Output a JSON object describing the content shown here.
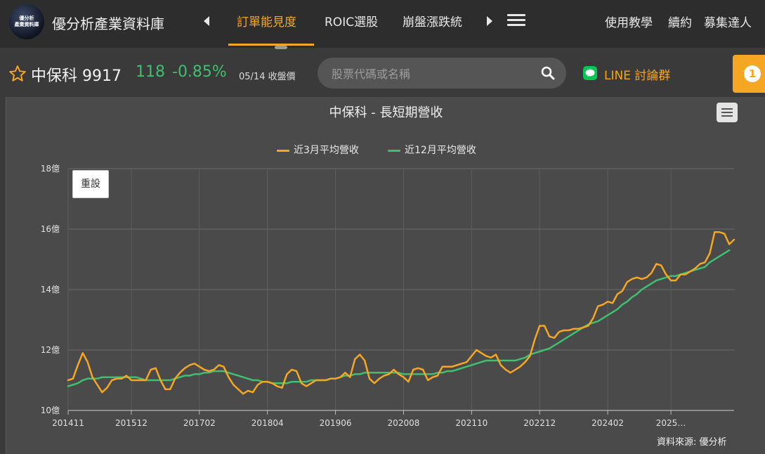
{
  "nav": {
    "logo_line1": "優分析",
    "logo_line2": "產業資料庫",
    "site_title": "優分析產業資料庫",
    "tabs": [
      "訂單能見度",
      "ROIC選股",
      "崩盤漲跌統"
    ],
    "active_tab": 0,
    "right_links": [
      "使用教學",
      "續約",
      "募集達人"
    ]
  },
  "stock": {
    "name": "中保科 9917",
    "price": "118",
    "change": "-0.85%",
    "date_label": "05/14 收盤價",
    "change_color": "#3fbf6f"
  },
  "search": {
    "placeholder": "股票代碼或名稱"
  },
  "line_group": {
    "label": "LINE 討論群"
  },
  "notification": {
    "count": "1"
  },
  "colors": {
    "accent": "#f5a623",
    "green": "#3fbf6f"
  },
  "chart": {
    "reset_label": "重設",
    "source_label": "資料來源: 優分析"
  },
  "chart_data": {
    "type": "line",
    "title": "中保科 - 長短期營收",
    "xlabel": "",
    "ylabel": "",
    "y_tick_labels": [
      "10億",
      "12億",
      "14億",
      "16億",
      "18億"
    ],
    "y_ticks": [
      10,
      12,
      14,
      16,
      18
    ],
    "ylim": [
      10,
      18
    ],
    "x_tick_labels": [
      "201411",
      "201512",
      "201702",
      "201804",
      "201906",
      "202008",
      "202110",
      "202212",
      "202402",
      "2025…"
    ],
    "x_tick_index": [
      0,
      13,
      27,
      41,
      55,
      69,
      83,
      97,
      111,
      124
    ],
    "grid": true,
    "legend_position": "top-center",
    "series": [
      {
        "name": "近3月平均營收",
        "color": "#f5a623",
        "values": [
          11.0,
          11.05,
          11.5,
          11.9,
          11.6,
          11.1,
          10.85,
          10.6,
          10.75,
          11.0,
          11.05,
          11.05,
          11.15,
          11.0,
          11.0,
          11.0,
          11.0,
          11.35,
          11.4,
          11.0,
          10.7,
          10.7,
          11.05,
          11.25,
          11.4,
          11.5,
          11.55,
          11.45,
          11.35,
          11.3,
          11.35,
          11.5,
          11.45,
          11.1,
          10.85,
          10.7,
          10.55,
          10.65,
          10.6,
          10.85,
          10.95,
          10.95,
          10.9,
          10.8,
          10.75,
          11.2,
          11.35,
          11.3,
          10.9,
          10.8,
          10.9,
          11.0,
          11.0,
          11.0,
          11.05,
          11.05,
          11.1,
          11.25,
          11.1,
          11.7,
          11.85,
          11.65,
          11.05,
          10.9,
          11.05,
          11.15,
          11.2,
          11.35,
          11.2,
          11.1,
          10.95,
          11.35,
          11.4,
          11.35,
          11.0,
          11.1,
          11.15,
          11.45,
          11.45,
          11.45,
          11.5,
          11.55,
          11.6,
          11.8,
          12.0,
          11.9,
          11.8,
          11.75,
          11.85,
          11.5,
          11.35,
          11.25,
          11.35,
          11.45,
          11.6,
          11.8,
          12.35,
          12.8,
          12.8,
          12.45,
          12.4,
          12.6,
          12.65,
          12.65,
          12.7,
          12.7,
          12.75,
          12.8,
          13.05,
          13.45,
          13.5,
          13.6,
          13.55,
          13.85,
          13.95,
          14.25,
          14.35,
          14.4,
          14.35,
          14.4,
          14.55,
          14.85,
          14.8,
          14.5,
          14.3,
          14.3,
          14.5,
          14.5,
          14.6,
          14.7,
          14.85,
          14.9,
          15.2,
          15.9,
          15.9,
          15.85,
          15.5,
          15.65
        ]
      },
      {
        "name": "近12月平均營收",
        "color": "#3fbf6f",
        "values": [
          10.8,
          10.85,
          10.9,
          11.0,
          11.05,
          11.05,
          11.05,
          11.1,
          11.1,
          11.1,
          11.1,
          11.1,
          11.1,
          11.1,
          11.1,
          11.05,
          11.0,
          11.0,
          11.0,
          11.0,
          11.0,
          11.0,
          11.05,
          11.1,
          11.15,
          11.15,
          11.2,
          11.2,
          11.25,
          11.25,
          11.3,
          11.3,
          11.3,
          11.25,
          11.2,
          11.15,
          11.1,
          11.05,
          11.0,
          11.0,
          10.95,
          10.95,
          10.9,
          10.9,
          10.9,
          10.9,
          10.95,
          10.95,
          10.95,
          10.95,
          11.0,
          11.0,
          11.0,
          11.0,
          11.05,
          11.05,
          11.1,
          11.15,
          11.15,
          11.2,
          11.2,
          11.25,
          11.25,
          11.25,
          11.25,
          11.25,
          11.25,
          11.25,
          11.25,
          11.2,
          11.2,
          11.2,
          11.2,
          11.2,
          11.2,
          11.2,
          11.25,
          11.25,
          11.3,
          11.3,
          11.35,
          11.4,
          11.45,
          11.5,
          11.55,
          11.6,
          11.65,
          11.65,
          11.65,
          11.65,
          11.65,
          11.65,
          11.65,
          11.7,
          11.75,
          11.85,
          11.9,
          11.95,
          12.0,
          12.05,
          12.15,
          12.25,
          12.35,
          12.45,
          12.55,
          12.65,
          12.75,
          12.85,
          12.9,
          12.95,
          13.05,
          13.15,
          13.25,
          13.35,
          13.5,
          13.6,
          13.75,
          13.85,
          14.0,
          14.1,
          14.2,
          14.3,
          14.35,
          14.4,
          14.45,
          14.45,
          14.5,
          14.55,
          14.6,
          14.65,
          14.7,
          14.75,
          14.9,
          15.0,
          15.1,
          15.2,
          15.3
        ]
      }
    ]
  }
}
